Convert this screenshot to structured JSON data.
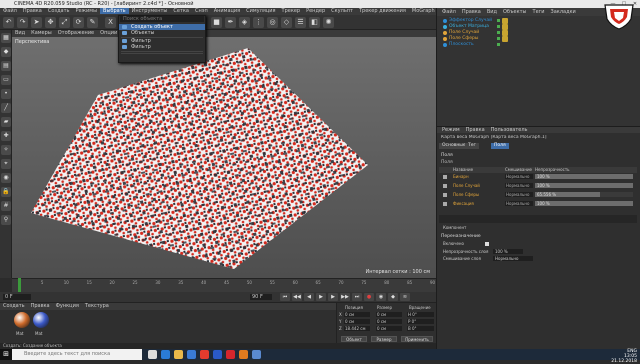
{
  "window": {
    "title": "CINEMA 4D R20.059 Studio (RC - R20) - [лабиринт 2.c4d *] - Основной",
    "minimize": "—",
    "maximize": "□",
    "close": "✕"
  },
  "menubar": {
    "items": [
      "Файл",
      "Правка",
      "Создать",
      "Режимы",
      "Выбрать",
      "Инструменты",
      "Сетка",
      "Снэп",
      "Анимация",
      "Симуляция",
      "Трекер",
      "Рендер",
      "Скульпт",
      "Трекер движения",
      "MoGraph",
      "Персонаж",
      "Конвейер",
      "Плагины",
      "Скрипт",
      "Окно",
      "Справка"
    ],
    "active_index": 4
  },
  "toolbar": {
    "icons": [
      "undo-icon",
      "redo-icon",
      "select-icon",
      "move-icon",
      "scale-icon",
      "rotate-icon",
      "recent-tool-icon",
      "x-axis-icon",
      "y-axis-icon",
      "z-axis-icon",
      "coord-system-icon",
      "render-view-icon",
      "render-picture-icon",
      "render-settings-icon",
      "cube-icon",
      "pen-icon",
      "subdivision-icon",
      "array-icon",
      "cloner-icon",
      "deformer-icon",
      "scene-icon",
      "camera-icon",
      "light-icon"
    ]
  },
  "search": {
    "placeholder": "Поиск объекта"
  },
  "dropdown": {
    "items": [
      {
        "label": "Создать объект",
        "highlight": true
      },
      {
        "label": "Объекты",
        "highlight": false
      },
      {
        "label": "",
        "highlight": false
      },
      {
        "label": "Фильтр",
        "highlight": false
      },
      {
        "label": "Фильтр",
        "highlight": false
      },
      {
        "label": "",
        "highlight": false
      },
      {
        "label": "",
        "highlight": false
      }
    ]
  },
  "viewport": {
    "menu": [
      "Вид",
      "Камеры",
      "Отображение",
      "Опции",
      "Фильтр",
      "Панель"
    ],
    "label": "Перспектива",
    "grid_scale": "Интервал сетки : 100 см",
    "accent_red": "#d42a1e",
    "tile_white": "#f2f2f2",
    "gap_dark": "#2a3038"
  },
  "left_tools": {
    "icons": [
      "make-editable-icon",
      "model-mode-icon",
      "texture-mode-icon",
      "workplane-icon",
      "points-mode-icon",
      "edges-mode-icon",
      "polygons-mode-icon",
      "axis-mode-icon",
      "tweak-icon",
      "snap-icon",
      "solo-icon",
      "lock-icon",
      "grid-icon",
      "magnet-icon"
    ]
  },
  "timeline": {
    "ticks": [
      "0",
      "5",
      "10",
      "15",
      "20",
      "25",
      "30",
      "35",
      "40",
      "45",
      "50",
      "55",
      "60",
      "65",
      "70",
      "75",
      "80",
      "85",
      "90"
    ],
    "current_frame": "0 F",
    "end_frame": "90 F",
    "playhead_fraction": 0.0
  },
  "transport": {
    "start_field": "0 F",
    "end_field": "90 F",
    "buttons": [
      "first-frame-icon",
      "prev-key-icon",
      "prev-frame-icon",
      "play-icon",
      "next-frame-icon",
      "next-key-icon",
      "last-frame-icon",
      "record-icon",
      "autokey-icon",
      "keyframe-icon",
      "motion-icon"
    ]
  },
  "materials": {
    "menu": [
      "Создать",
      "Правка",
      "Функция",
      "Текстура"
    ],
    "items": [
      {
        "name": "Mat",
        "color": "#cf6a2a"
      },
      {
        "name": "Mat",
        "color": "#3b59c8"
      }
    ]
  },
  "coords": {
    "headers": [
      "Позиция",
      "Размер",
      "Вращение"
    ],
    "rows": [
      {
        "axis": "X",
        "pos": "0 см",
        "size": "0 см",
        "rot": "H 0°"
      },
      {
        "axis": "Y",
        "pos": "0 см",
        "size": "0 см",
        "rot": "P 0°"
      },
      {
        "axis": "Z",
        "pos": "18.442 см",
        "size": "0 см",
        "rot": "B 0°"
      }
    ],
    "mode1": "Объект",
    "mode2": "Размер",
    "apply": "Применить"
  },
  "status": {
    "text": "Создать: Создание объекта"
  },
  "object_manager": {
    "menu": [
      "Файл",
      "Правка",
      "Вид",
      "Объекты",
      "Теги",
      "Закладки"
    ],
    "objects": [
      {
        "name": "Эффектор Случай",
        "color": "#2e8fd8",
        "indent": 2,
        "tag": true
      },
      {
        "name": "Объект Матрица",
        "color": "#3ab0e0",
        "indent": 2,
        "tag": true
      },
      {
        "name": "Поле Случай",
        "color": "#e2a53a",
        "indent": 2,
        "tag": true
      },
      {
        "name": "Поле Сферы",
        "color": "#e2a53a",
        "indent": 2,
        "tag": true
      },
      {
        "name": "Плоскость",
        "color": "#2e8fd8",
        "indent": 2,
        "tag": false
      }
    ]
  },
  "attributes": {
    "menu": [
      "Режим",
      "Правка",
      "Пользователь"
    ],
    "title": "Карта веса MoGraph [Карта веса MoGraph.1]",
    "tabs": [
      "Основные",
      "Тег",
      "Поля"
    ],
    "active_tab": 2,
    "section": "Поля",
    "subsection": "Поля",
    "columns": [
      "Название",
      "Смешивание",
      "Непрозрачность"
    ],
    "fields": [
      {
        "name": "Бинарн",
        "mode": "Нормально",
        "pct": "100 %",
        "fill": 1.0
      },
      {
        "name": "Поле Случай",
        "mode": "Нормально",
        "pct": "100 %",
        "fill": 1.0
      },
      {
        "name": "Поле Сферы",
        "mode": "Нормально",
        "pct": "65.556 %",
        "fill": 0.66
      },
      {
        "name": "Фиксация",
        "mode": "Нормально",
        "pct": "100 %",
        "fill": 1.0
      }
    ],
    "info": "Компонент",
    "remap_title": "Переназначение",
    "enable_label": "Включено",
    "opacity_label": "Непрозрачность слоя",
    "opacity_value": "100 %",
    "blend_label": "Смешивание слоя",
    "blend_value": "Нормально"
  },
  "taskbar": {
    "search_placeholder": "Введите здесь текст для поиска",
    "apps": [
      {
        "name": "task-view-icon",
        "color": "#dddddd"
      },
      {
        "name": "edge-icon",
        "color": "#2a7bd6"
      },
      {
        "name": "explorer-icon",
        "color": "#e8b84a"
      },
      {
        "name": "store-icon",
        "color": "#3a7bd5"
      },
      {
        "name": "chrome-icon",
        "color": "#e23b2e"
      },
      {
        "name": "c4d-icon",
        "color": "#2a5ac8"
      },
      {
        "name": "opera-icon",
        "color": "#d4262d"
      },
      {
        "name": "media-icon",
        "color": "#e07a1f"
      },
      {
        "name": "photo-icon",
        "color": "#5a8ad0"
      }
    ],
    "lang": "ENG",
    "clock": "13:05",
    "date": "21.12.2018"
  }
}
